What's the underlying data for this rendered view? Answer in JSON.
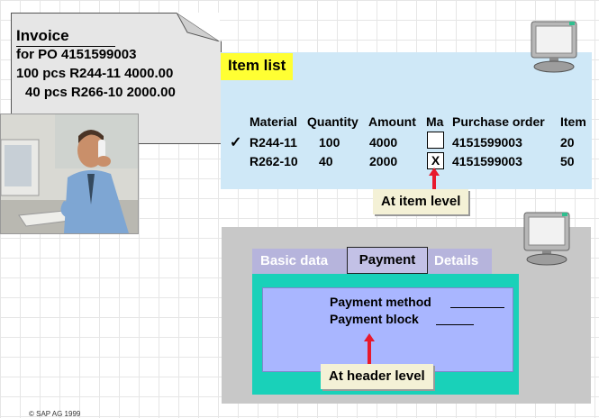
{
  "invoice": {
    "title": "Invoice",
    "lines": [
      "for PO 4151599003",
      "100 pcs R244-11 4000.00",
      "40 pcs R266-10 2000.00"
    ]
  },
  "item_list": {
    "title": "Item list",
    "columns": [
      "Material",
      "Quantity",
      "Amount",
      "Ma",
      "Purchase order",
      "Item"
    ],
    "rows": [
      {
        "selected": "✓",
        "material": "R244-11",
        "quantity": "100",
        "amount": "4000",
        "ma": "",
        "po": "4151599003",
        "item": "20"
      },
      {
        "selected": "",
        "material": "R262-10",
        "quantity": "40",
        "amount": "2000",
        "ma": "X",
        "po": "4151599003",
        "item": "50"
      }
    ],
    "callout": "At item level"
  },
  "payment": {
    "tabs": [
      "Basic data",
      "Payment",
      "Details"
    ],
    "fields": [
      "Payment method",
      "Payment block"
    ],
    "callout": "At header level"
  },
  "colors": {
    "highlight": "#ffff33",
    "item_panel": "#cfe8f7",
    "tab_frame": "#19d1b9",
    "field_area": "#a9b6ff",
    "arrow": "#e8192c"
  },
  "icons": [
    "computer-monitor-icon",
    "computer-monitor-icon"
  ],
  "copyright": "© SAP AG 1999"
}
